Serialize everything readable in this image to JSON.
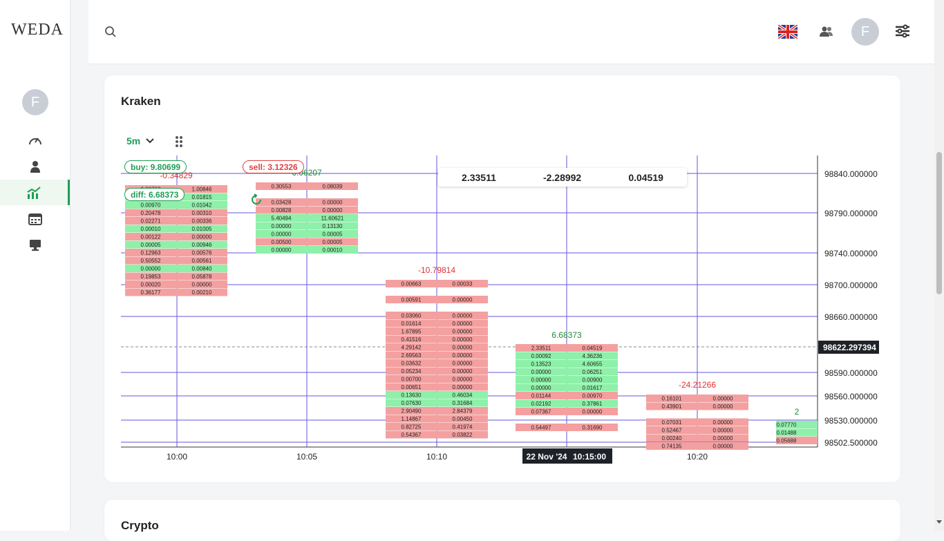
{
  "app": {
    "logo_text": "WEDA",
    "user_initial": "F"
  },
  "sidebar": {
    "items": [
      {
        "icon": "dashboard-icon"
      },
      {
        "icon": "user-icon"
      },
      {
        "icon": "chart-icon",
        "active": true
      },
      {
        "icon": "calendar-icon"
      },
      {
        "icon": "monitor-icon"
      }
    ]
  },
  "header": {
    "search_icon": "search-icon",
    "language_icon": "uk-flag-icon",
    "users_icon": "users-icon",
    "settings_icon": "sliders-icon"
  },
  "card": {
    "title": "Kraken",
    "timeframe": "5m",
    "buy_label": "buy: 9.80699",
    "sell_label": "sell: 3.12326",
    "diff_label": "diff: 6.68373"
  },
  "stats": {
    "a": "2.33511",
    "b": "-2.28992",
    "c": "0.04519"
  },
  "next_card": {
    "title": "Crypto"
  },
  "colors": {
    "accent": "#1f9d55",
    "buy_cell": "#8ef0a9",
    "sell_cell": "#f4a0a0",
    "grid": "#6655dd",
    "price_red": "#e03030",
    "price_green": "#1f8a3a"
  },
  "chart_data": {
    "type": "table",
    "y_ticks": [
      "98840.000000",
      "98790.000000",
      "98740.000000",
      "98700.000000",
      "98660.000000",
      "98622.297394",
      "98590.000000",
      "98560.000000",
      "98530.000000",
      "98502.500000"
    ],
    "x_ticks": [
      "10:00",
      "10:05",
      "10:10",
      "10:20"
    ],
    "crosshair_date": "22 Nov '24",
    "crosshair_time": "10:15:00",
    "columns": [
      {
        "delta": "-0.34829",
        "delta_color": "red",
        "rows": [
          [
            "0.00763",
            "1.00846",
            "red"
          ],
          [
            "0.00891",
            "0.01815",
            "green"
          ],
          [
            "0.00970",
            "0.01042",
            "green"
          ],
          [
            "0.20478",
            "0.00310",
            "red"
          ],
          [
            "0.02271",
            "0.00336",
            "red"
          ],
          [
            "0.00010",
            "0.01005",
            "green"
          ],
          [
            "0.00122",
            "0.00000",
            "red"
          ],
          [
            "0.00005",
            "0.00946",
            "green"
          ],
          [
            "0.12963",
            "0.00576",
            "red"
          ],
          [
            "0.50552",
            "0.00561",
            "red"
          ],
          [
            "0.00000",
            "0.00840",
            "green"
          ],
          [
            "0.19853",
            "0.05878",
            "red"
          ],
          [
            "0.00020",
            "0.00000",
            "red"
          ],
          [
            "0.36177",
            "0.00210",
            "red"
          ]
        ]
      },
      {
        "delta": "6.06207",
        "delta_color": "green",
        "rows": [
          [
            "0.30553",
            "0.08039",
            "red"
          ],
          [
            "",
            "",
            " "
          ],
          [
            "0.03428",
            "0.00000",
            "red"
          ],
          [
            "0.00828",
            "0.00000",
            "red"
          ],
          [
            "5.40494",
            "11.60621",
            "green"
          ],
          [
            "0.00000",
            "0.13130",
            "green"
          ],
          [
            "0.00000",
            "0.00005",
            "green"
          ],
          [
            "0.00500",
            "0.00005",
            "red"
          ],
          [
            "0.00000",
            "0.00010",
            "green"
          ]
        ]
      },
      {
        "delta": "-10.79814",
        "delta_color": "red",
        "rows": [
          [
            "0.00663",
            "0.00033",
            "red"
          ],
          [
            "",
            "",
            " "
          ],
          [
            "0.00591",
            "0.00000",
            "red"
          ],
          [
            "",
            "",
            " "
          ],
          [
            "0.03060",
            "0.00000",
            "red"
          ],
          [
            "0.01614",
            "0.00000",
            "red"
          ],
          [
            "1.67895",
            "0.00000",
            "red"
          ],
          [
            "0.41516",
            "0.00000",
            "red"
          ],
          [
            "4.29142",
            "0.00000",
            "red"
          ],
          [
            "2.69563",
            "0.00000",
            "red"
          ],
          [
            "0.03632",
            "0.00000",
            "red"
          ],
          [
            "0.05234",
            "0.00000",
            "red"
          ],
          [
            "0.00700",
            "0.00000",
            "red"
          ],
          [
            "0.00651",
            "0.00000",
            "red"
          ],
          [
            "0.13630",
            "0.46034",
            "green"
          ],
          [
            "0.07630",
            "0.31684",
            "green"
          ],
          [
            "2.90490",
            "2.84379",
            "red"
          ],
          [
            "1.14867",
            "0.00450",
            "red"
          ],
          [
            "0.82725",
            "0.41974",
            "red"
          ],
          [
            "0.54367",
            "0.03822",
            "red"
          ]
        ]
      },
      {
        "delta": "6.68373",
        "delta_color": "green",
        "rows": [
          [
            "2.33511",
            "0.04519",
            "red"
          ],
          [
            "0.00092",
            "4.36236",
            "green"
          ],
          [
            "0.13523",
            "4.60655",
            "green"
          ],
          [
            "0.00000",
            "0.06251",
            "green"
          ],
          [
            "0.00000",
            "0.00900",
            "green"
          ],
          [
            "0.00000",
            "0.01617",
            "green"
          ],
          [
            "0.01144",
            "0.00970",
            "red"
          ],
          [
            "0.02192",
            "0.37861",
            "green"
          ],
          [
            "0.07367",
            "0.00000",
            "red"
          ],
          [
            "",
            "",
            " "
          ],
          [
            "0.54497",
            "0.31690",
            "red"
          ]
        ]
      },
      {
        "delta": "-24.21266",
        "delta_color": "red",
        "rows": [
          [
            "0.16101",
            "0.00000",
            "red"
          ],
          [
            "0.43901",
            "0.00000",
            "red"
          ],
          [
            "",
            "",
            " "
          ],
          [
            "0.07031",
            "0.00000",
            "red"
          ],
          [
            "0.52467",
            "0.00000",
            "red"
          ],
          [
            "0.00240",
            "0.00000",
            "red"
          ],
          [
            "0.74135",
            "0.00000",
            "red"
          ]
        ]
      },
      {
        "delta": "2",
        "delta_color": "green",
        "rows": [
          [
            "0.07770",
            "",
            "green"
          ],
          [
            "0.01488",
            "",
            "green"
          ],
          [
            "0.05688",
            "",
            "red"
          ]
        ]
      }
    ]
  }
}
